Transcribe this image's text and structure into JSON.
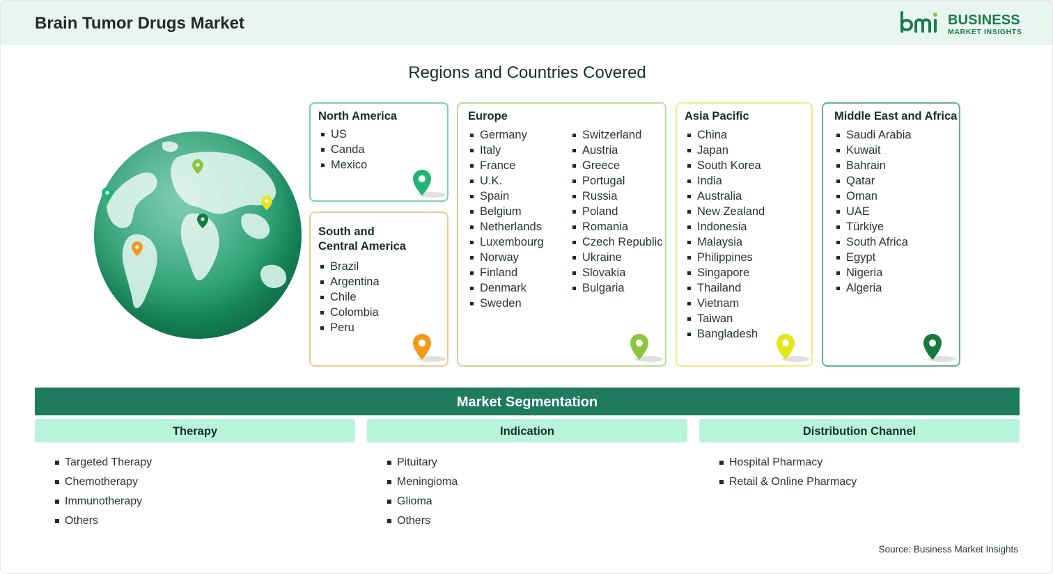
{
  "header": {
    "title": "Brain Tumor Drugs Market",
    "logo": {
      "line1": "BUSINESS",
      "line2": "MARKET INSIGHTS",
      "mark_text": "bmi"
    }
  },
  "regions_title": "Regions and Countries Covered",
  "regions": [
    {
      "name": "North America",
      "items": [
        "US",
        "Canda",
        "Mexico"
      ],
      "pin_color": "#21b573",
      "border": "#7fcfae"
    },
    {
      "name": "South and Central America",
      "name_lines": [
        "South and",
        "Central America"
      ],
      "items": [
        "Brazil",
        "Argentina",
        "Chile",
        "Colombia",
        "Peru"
      ],
      "pin_color": "#f39a1c",
      "border": "#f4c98e"
    },
    {
      "name": "Europe",
      "items_col1": [
        "Germany",
        "Italy",
        "France",
        "U.K.",
        "Spain",
        "Belgium",
        "Netherlands",
        "Luxembourg",
        "Norway",
        "Finland",
        "Denmark",
        "Sweden"
      ],
      "items_col2": [
        "Switzerland",
        "Austria",
        "Greece",
        "Portugal",
        "Russia",
        "Poland",
        "Romania",
        "Czech Republic",
        "Ukraine",
        "Slovakia",
        "Bulgaria"
      ],
      "pin_color": "#8cc63f",
      "border": "#b9dd92"
    },
    {
      "name": "Asia Pacific",
      "items": [
        "China",
        "Japan",
        "South Korea",
        "India",
        "Australia",
        "New Zealand",
        "Indonesia",
        "Malaysia",
        "Philippines",
        "Singapore",
        "Thailand",
        "Vietnam",
        "Taiwan",
        "Bangladesh"
      ],
      "pin_color": "#e6e619",
      "border": "#ecec8a"
    },
    {
      "name": "Middle East and Africa",
      "items": [
        "Saudi Arabia",
        "Kuwait",
        "Bahrain",
        "Qatar",
        "Oman",
        "UAE",
        "Türkiye",
        "South Africa",
        "Egypt",
        "Nigeria",
        "Algeria"
      ],
      "pin_color": "#157a3d",
      "border": "#62b38a"
    }
  ],
  "segmentation": {
    "title": "Market Segmentation",
    "columns": [
      {
        "name": "Therapy",
        "items": [
          "Targeted Therapy",
          "Chemotherapy",
          "Immunotherapy",
          "Others"
        ]
      },
      {
        "name": "Indication",
        "items": [
          "Pituitary",
          "Meningioma",
          "Glioma",
          "Others"
        ]
      },
      {
        "name": "Distribution Channel",
        "items": [
          "Hospital Pharmacy",
          "Retail & Online Pharmacy"
        ]
      }
    ]
  },
  "source": "Source: Business Market Insights",
  "colors": {
    "header_bg": "#e9f6ef",
    "brand_green": "#1e7b5d",
    "segment_head_bg": "#b8f3dc"
  }
}
